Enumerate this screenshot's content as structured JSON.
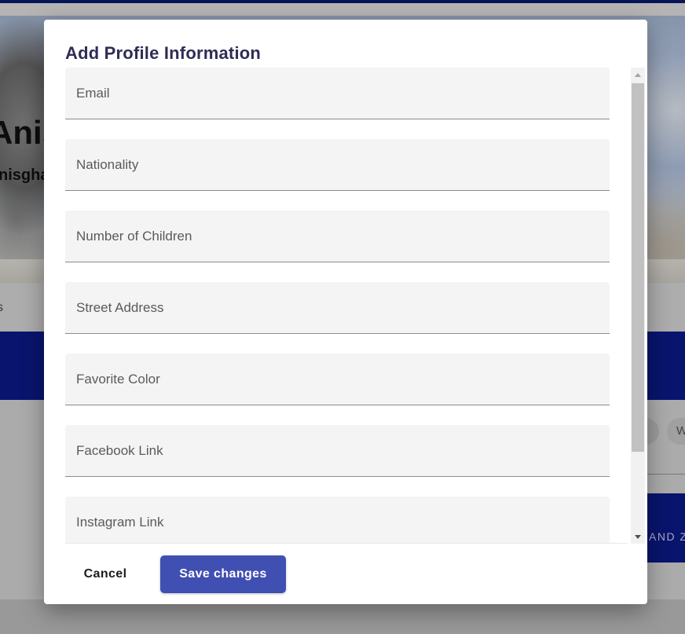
{
  "background": {
    "profile_name": "Anis",
    "profile_handle": "nisgha",
    "tab_label": "s",
    "chip_label": "W",
    "button_label": "AND Z"
  },
  "dialog": {
    "title": "Add Profile Information",
    "fields": [
      {
        "placeholder": "Email",
        "value": ""
      },
      {
        "placeholder": "Nationality",
        "value": ""
      },
      {
        "placeholder": "Number of Children",
        "value": ""
      },
      {
        "placeholder": "Street Address",
        "value": ""
      },
      {
        "placeholder": "Favorite Color",
        "value": ""
      },
      {
        "placeholder": "Facebook Link",
        "value": ""
      },
      {
        "placeholder": "Instagram Link",
        "value": ""
      }
    ],
    "cancel_label": "Cancel",
    "save_label": "Save changes"
  },
  "colors": {
    "primary_button": "#3f4fb2",
    "title_text": "#2f2c55",
    "navy_band": "#0c1a8e"
  }
}
